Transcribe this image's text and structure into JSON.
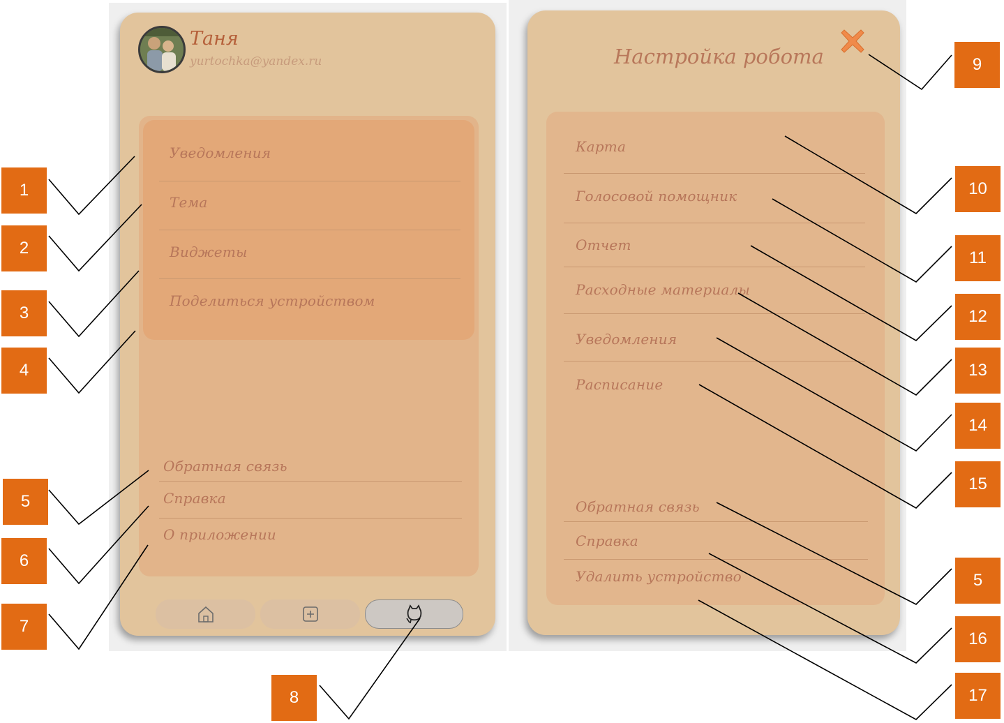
{
  "profile": {
    "name": "Таня",
    "email": "yurtochka@yandex.ru"
  },
  "settings_menu": {
    "items": [
      {
        "label": "Уведомления"
      },
      {
        "label": "Тема"
      },
      {
        "label": "Виджеты"
      },
      {
        "label": "Поделиться устройством"
      }
    ]
  },
  "settings_footer": {
    "items": [
      {
        "label": "Обратная связь"
      },
      {
        "label": "Справка"
      },
      {
        "label": "О приложении"
      }
    ]
  },
  "bottom_nav": [
    {
      "icon": "home-icon"
    },
    {
      "icon": "add-icon"
    },
    {
      "icon": "robot-cat-icon"
    }
  ],
  "robot_settings": {
    "title": "Настройка робота",
    "close_icon": "close-icon",
    "items": [
      {
        "label": "Карта"
      },
      {
        "label": "Голосовой помощник"
      },
      {
        "label": "Отчет"
      },
      {
        "label": "Расходные материалы"
      },
      {
        "label": "Уведомления"
      },
      {
        "label": "Расписание"
      }
    ],
    "footer_items": [
      {
        "label": "Обратная связь"
      },
      {
        "label": "Справка"
      },
      {
        "label": "Удалить устройство"
      }
    ]
  },
  "callouts": [
    "1",
    "2",
    "3",
    "4",
    "5",
    "6",
    "7",
    "8",
    "9",
    "10",
    "11",
    "12",
    "13",
    "14",
    "15",
    "5",
    "16",
    "17"
  ],
  "colors": {
    "card": "#e2c49c",
    "panel_left": "#e3ab7c",
    "panel_right": "#e2b68d",
    "text": "#b7765a",
    "callout": "#e26b14",
    "close": "#f08a4a"
  }
}
